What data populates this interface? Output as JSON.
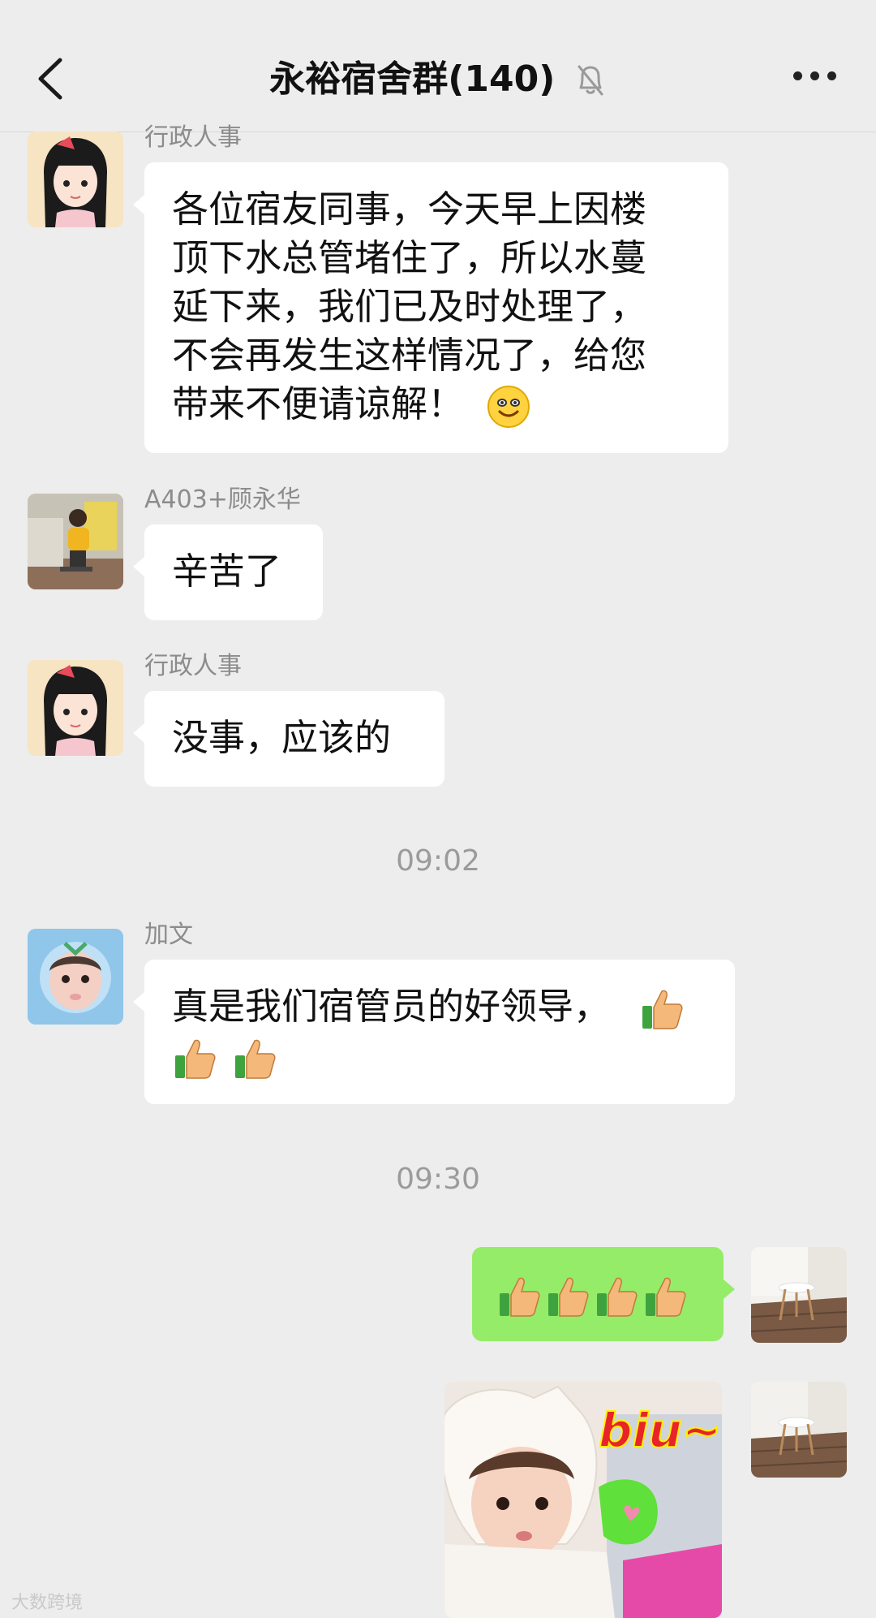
{
  "header": {
    "title": "永裕宿舍群(140)",
    "back_icon": "chevron-left-icon",
    "mute_icon": "bell-muted-icon",
    "more_icon": "more-dots-icon"
  },
  "messages": [
    {
      "sender": "行政人事",
      "text": "各位宿友同事，今天早上因楼顶下水总管堵住了，所以水蔓延下来，我们已及时处理了，不会再发生这样情况了，给您带来不便请谅解！",
      "lines": [
        "各位宿友同事，今天早上因楼",
        "顶下水总管堵住了，所以水蔓",
        "延下来，我们已及时处理了，",
        "不会再发生这样情况了，给您",
        "带来不便请谅解！"
      ],
      "emoji": "smile-emoji"
    },
    {
      "sender": "A403+顾永华",
      "text": "辛苦了"
    },
    {
      "sender": "行政人事",
      "text": "没事，应该的"
    },
    {
      "sender": "加文",
      "text": "真是我们宿管员的好领导，",
      "emoji": "thumbs-up-emoji"
    },
    {
      "sender": "",
      "text": "",
      "emoji": "thumbs-up-emoji",
      "count": 4
    }
  ],
  "timestamps": [
    "09:02",
    "09:30"
  ],
  "sticker": {
    "text": "biu~"
  },
  "watermark": "大数跨境",
  "colors": {
    "background": "#ededed",
    "bubble_in": "#ffffff",
    "bubble_out": "#95ec69"
  }
}
